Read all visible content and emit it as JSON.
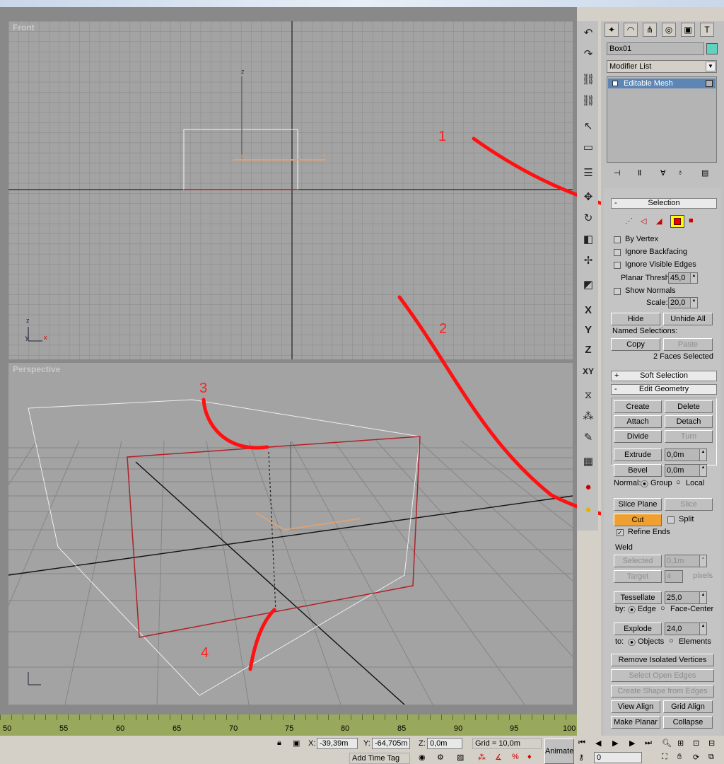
{
  "viewports": {
    "front": {
      "label": "Front"
    },
    "perspective": {
      "label": "Perspective"
    }
  },
  "toolbar_axes": [
    "X",
    "Y",
    "Z",
    "XY"
  ],
  "command_panel": {
    "tabs": [
      "create-icon",
      "modify-icon",
      "hierarchy-icon",
      "motion-icon",
      "display-icon",
      "utilities-icon"
    ],
    "object_name": "Box01",
    "object_color": "#5fd3bf",
    "modifier_list": "Modifier List",
    "stack_item": "Editable Mesh",
    "selection": {
      "title": "Selection",
      "by_vertex": "By Vertex",
      "ignore_backfacing": "Ignore Backfacing",
      "ignore_visible_edges": "Ignore Visible Edges",
      "planar_thresh_label": "Planar Thresh:",
      "planar_thresh": "45,0",
      "show_normals": "Show Normals",
      "scale_label": "Scale:",
      "scale": "20,0",
      "hide": "Hide",
      "unhide_all": "Unhide All",
      "named_selections": "Named Selections:",
      "copy": "Copy",
      "paste": "Paste",
      "faces_selected": "2 Faces Selected"
    },
    "soft_selection": {
      "title": "Soft Selection"
    },
    "edit_geometry": {
      "title": "Edit Geometry",
      "create": "Create",
      "delete": "Delete",
      "attach": "Attach",
      "detach": "Detach",
      "divide": "Divide",
      "turn": "Turn",
      "extrude": "Extrude",
      "extrude_val": "0,0m",
      "bevel": "Bevel",
      "bevel_val": "0,0m",
      "normal_label": "Normal:",
      "group": "Group",
      "local": "Local",
      "slice_plane": "Slice Plane",
      "slice": "Slice",
      "cut": "Cut",
      "split": "Split",
      "refine_ends": "Refine Ends",
      "weld": "Weld",
      "selected": "Selected",
      "selected_val": "0,1m",
      "target": "Target",
      "target_val": "4",
      "pixels": "pixels",
      "tessellate": "Tessellate",
      "tessellate_val": "25,0",
      "by_label": "by:",
      "edge": "Edge",
      "face_center": "Face-Center",
      "explode": "Explode",
      "explode_val": "24,0",
      "to_label": "to:",
      "objects": "Objects",
      "elements": "Elements",
      "remove_isolated": "Remove Isolated Vertices",
      "select_open_edges": "Select Open Edges",
      "create_shape": "Create Shape from Edges",
      "view_align": "View Align",
      "grid_align": "Grid Align",
      "make_planar": "Make Planar",
      "collapse": "Collapse"
    }
  },
  "timeline": {
    "ticks": [
      "50",
      "55",
      "60",
      "65",
      "70",
      "75",
      "80",
      "85",
      "90",
      "95",
      "100"
    ]
  },
  "status": {
    "x_label": "X:",
    "x": "-39,39m",
    "y_label": "Y:",
    "y": "-64,705m",
    "z_label": "Z:",
    "z": "0,0m",
    "grid": "Grid = 10,0m",
    "animate": "Animate",
    "add_time_tag": "Add Time Tag",
    "frame": "0"
  },
  "annotations": [
    "1",
    "2",
    "3",
    "4"
  ]
}
